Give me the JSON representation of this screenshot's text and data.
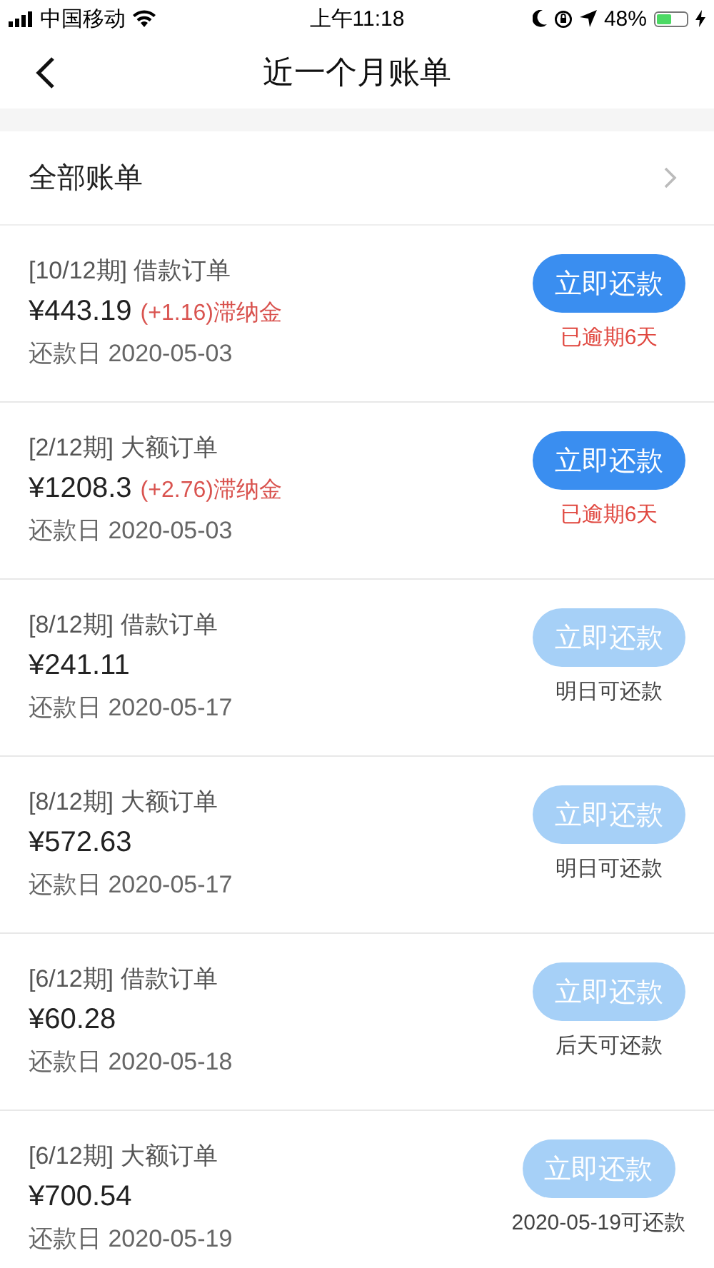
{
  "status_bar": {
    "carrier": "中国移动",
    "time": "上午11:18",
    "battery": "48%"
  },
  "nav": {
    "title": "近一个月账单"
  },
  "filter": {
    "label": "全部账单"
  },
  "bills": [
    {
      "period": "[10/12期]",
      "type": "借款订单",
      "amount": "¥443.19",
      "late_fee": "(+1.16)滞纳金",
      "due": "还款日 2020-05-03",
      "button": "立即还款",
      "disabled": false,
      "note": "已逾期6天",
      "kind": "overdue"
    },
    {
      "period": "[2/12期]",
      "type": "大额订单",
      "amount": "¥1208.3",
      "late_fee": "(+2.76)滞纳金",
      "due": "还款日 2020-05-03",
      "button": "立即还款",
      "disabled": false,
      "note": "已逾期6天",
      "kind": "overdue"
    },
    {
      "period": "[8/12期]",
      "type": "借款订单",
      "amount": "¥241.11",
      "due": "还款日 2020-05-17",
      "button": "立即还款",
      "disabled": true,
      "note": "明日可还款",
      "kind": "upcoming"
    },
    {
      "period": "[8/12期]",
      "type": "大额订单",
      "amount": "¥572.63",
      "due": "还款日 2020-05-17",
      "button": "立即还款",
      "disabled": true,
      "note": "明日可还款",
      "kind": "upcoming"
    },
    {
      "period": "[6/12期]",
      "type": "借款订单",
      "amount": "¥60.28",
      "due": "还款日 2020-05-18",
      "button": "立即还款",
      "disabled": true,
      "note": "后天可还款",
      "kind": "upcoming"
    },
    {
      "period": "[6/12期]",
      "type": "大额订单",
      "amount": "¥700.54",
      "due": "还款日 2020-05-19",
      "button": "立即还款",
      "disabled": true,
      "note": "2020-05-19可还款",
      "kind": "upcoming"
    }
  ]
}
